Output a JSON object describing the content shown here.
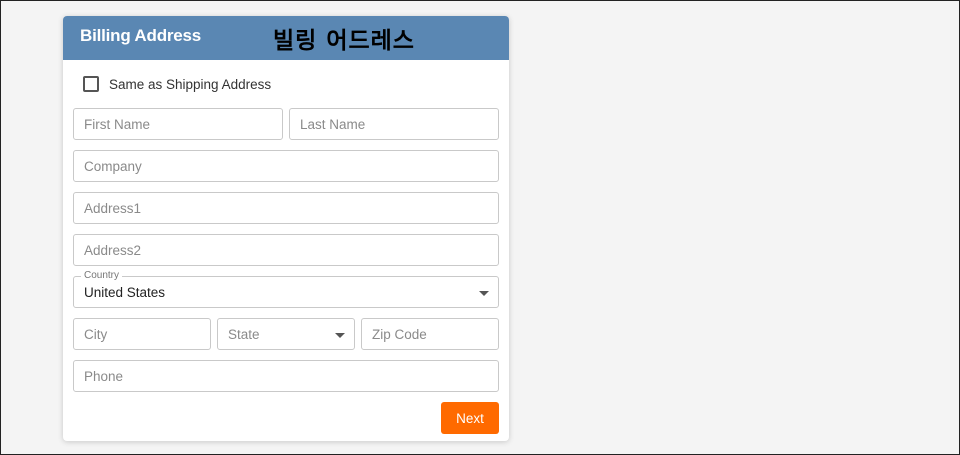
{
  "form": {
    "title": "Billing Address",
    "korean_title": "빌링 어드레스",
    "same_as_shipping": {
      "label": "Same as Shipping Address",
      "checked": false
    },
    "fields": {
      "first_name": {
        "placeholder": "First Name",
        "value": ""
      },
      "last_name": {
        "placeholder": "Last Name",
        "value": ""
      },
      "company": {
        "placeholder": "Company",
        "value": ""
      },
      "address1": {
        "placeholder": "Address1",
        "value": ""
      },
      "address2": {
        "placeholder": "Address2",
        "value": ""
      },
      "country": {
        "label": "Country",
        "value": "United States"
      },
      "city": {
        "placeholder": "City",
        "value": ""
      },
      "state": {
        "placeholder": "State"
      },
      "zip": {
        "placeholder": "Zip Code",
        "value": ""
      },
      "phone": {
        "placeholder": "Phone",
        "value": ""
      }
    },
    "next_label": "Next"
  },
  "colors": {
    "header_bg": "#5a87b3",
    "accent_button": "#ff6a00",
    "page_bg": "#f4f4f4"
  },
  "icons": {
    "checkbox": "checkbox-unchecked-icon",
    "dropdown": "caret-down-icon"
  }
}
